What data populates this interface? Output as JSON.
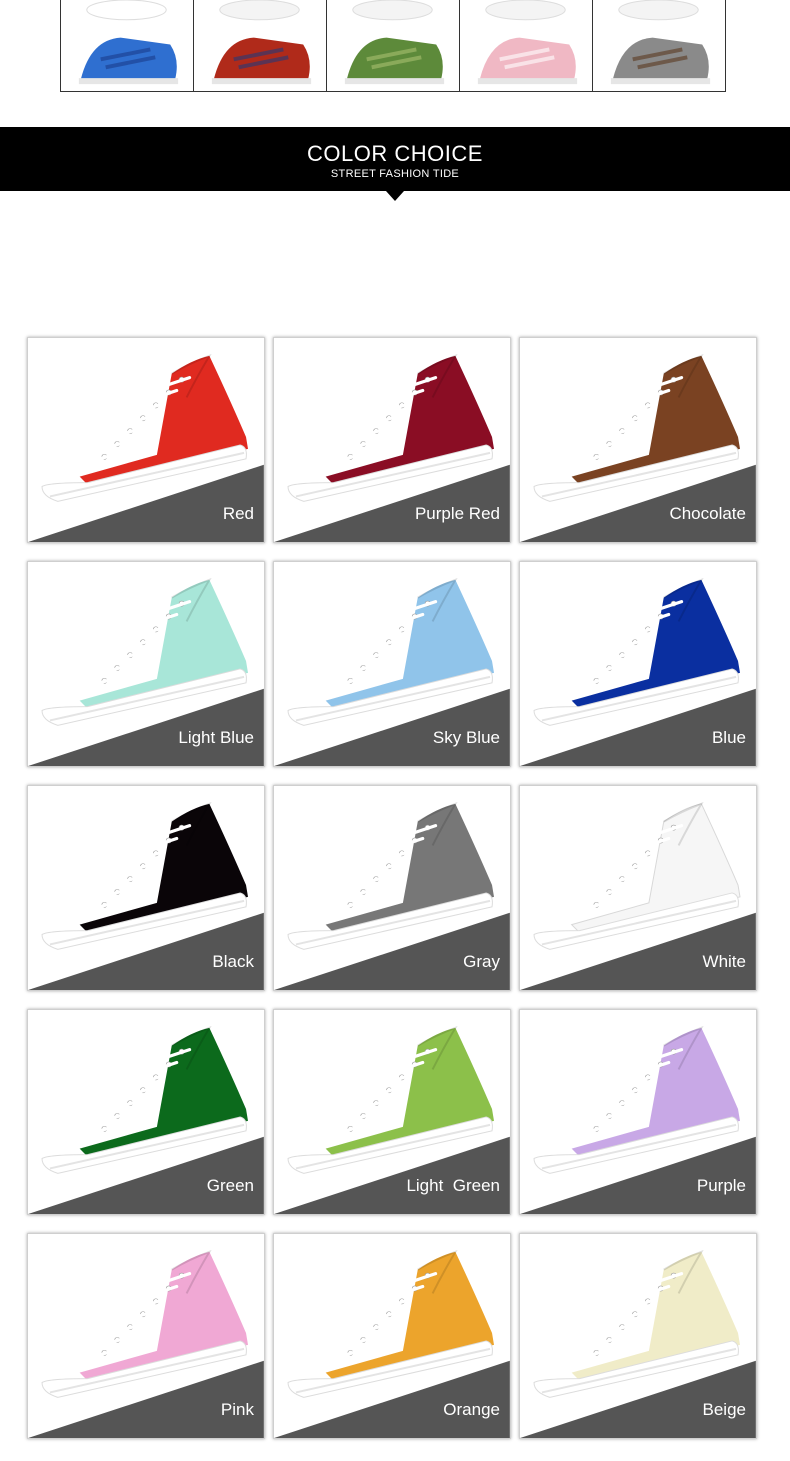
{
  "thumbnail_strip": {
    "cells": [
      {
        "name": "thumb-1",
        "top_color": "#ffffff",
        "bottom_color": "#2f6fd0",
        "accent": "#1a3d8c"
      },
      {
        "name": "thumb-2",
        "top_color": "#f4f4f4",
        "bottom_color": "#b02a1a",
        "accent": "#243a7a"
      },
      {
        "name": "thumb-3",
        "top_color": "#f4f4f4",
        "bottom_color": "#5d8a3a",
        "accent": "#a8c070"
      },
      {
        "name": "thumb-4",
        "top_color": "#f4f4f4",
        "bottom_color": "#f0b8c4",
        "accent": "#ffffff"
      },
      {
        "name": "thumb-5",
        "top_color": "#f4f4f4",
        "bottom_color": "#8a8a8a",
        "accent": "#5a3a20"
      }
    ]
  },
  "banner": {
    "title": "COLOR CHOICE",
    "subtitle": "STREET FASHION TIDE"
  },
  "colors": [
    {
      "label": "Red",
      "hex": "#e02a20"
    },
    {
      "label": "Purple Red",
      "hex": "#8a0d24"
    },
    {
      "label": "Chocolate",
      "hex": "#7a4222"
    },
    {
      "label": "Light Blue",
      "hex": "#a8e6d8"
    },
    {
      "label": "Sky Blue",
      "hex": "#90c4ea"
    },
    {
      "label": "Blue",
      "hex": "#0a2fa0"
    },
    {
      "label": "Black",
      "hex": "#0a0508"
    },
    {
      "label": "Gray",
      "hex": "#777777"
    },
    {
      "label": "White",
      "hex": "#f6f6f6"
    },
    {
      "label": "Green",
      "hex": "#0c6a1c"
    },
    {
      "label": "Light  Green",
      "hex": "#8cc04a"
    },
    {
      "label": "Purple",
      "hex": "#c8a8e6"
    },
    {
      "label": "Pink",
      "hex": "#f0a8d4"
    },
    {
      "label": "Orange",
      "hex": "#eca42c"
    },
    {
      "label": "Beige",
      "hex": "#f0ecc8"
    }
  ],
  "style": {
    "label_band_color": "#555555",
    "sole_color": "#ffffff"
  }
}
